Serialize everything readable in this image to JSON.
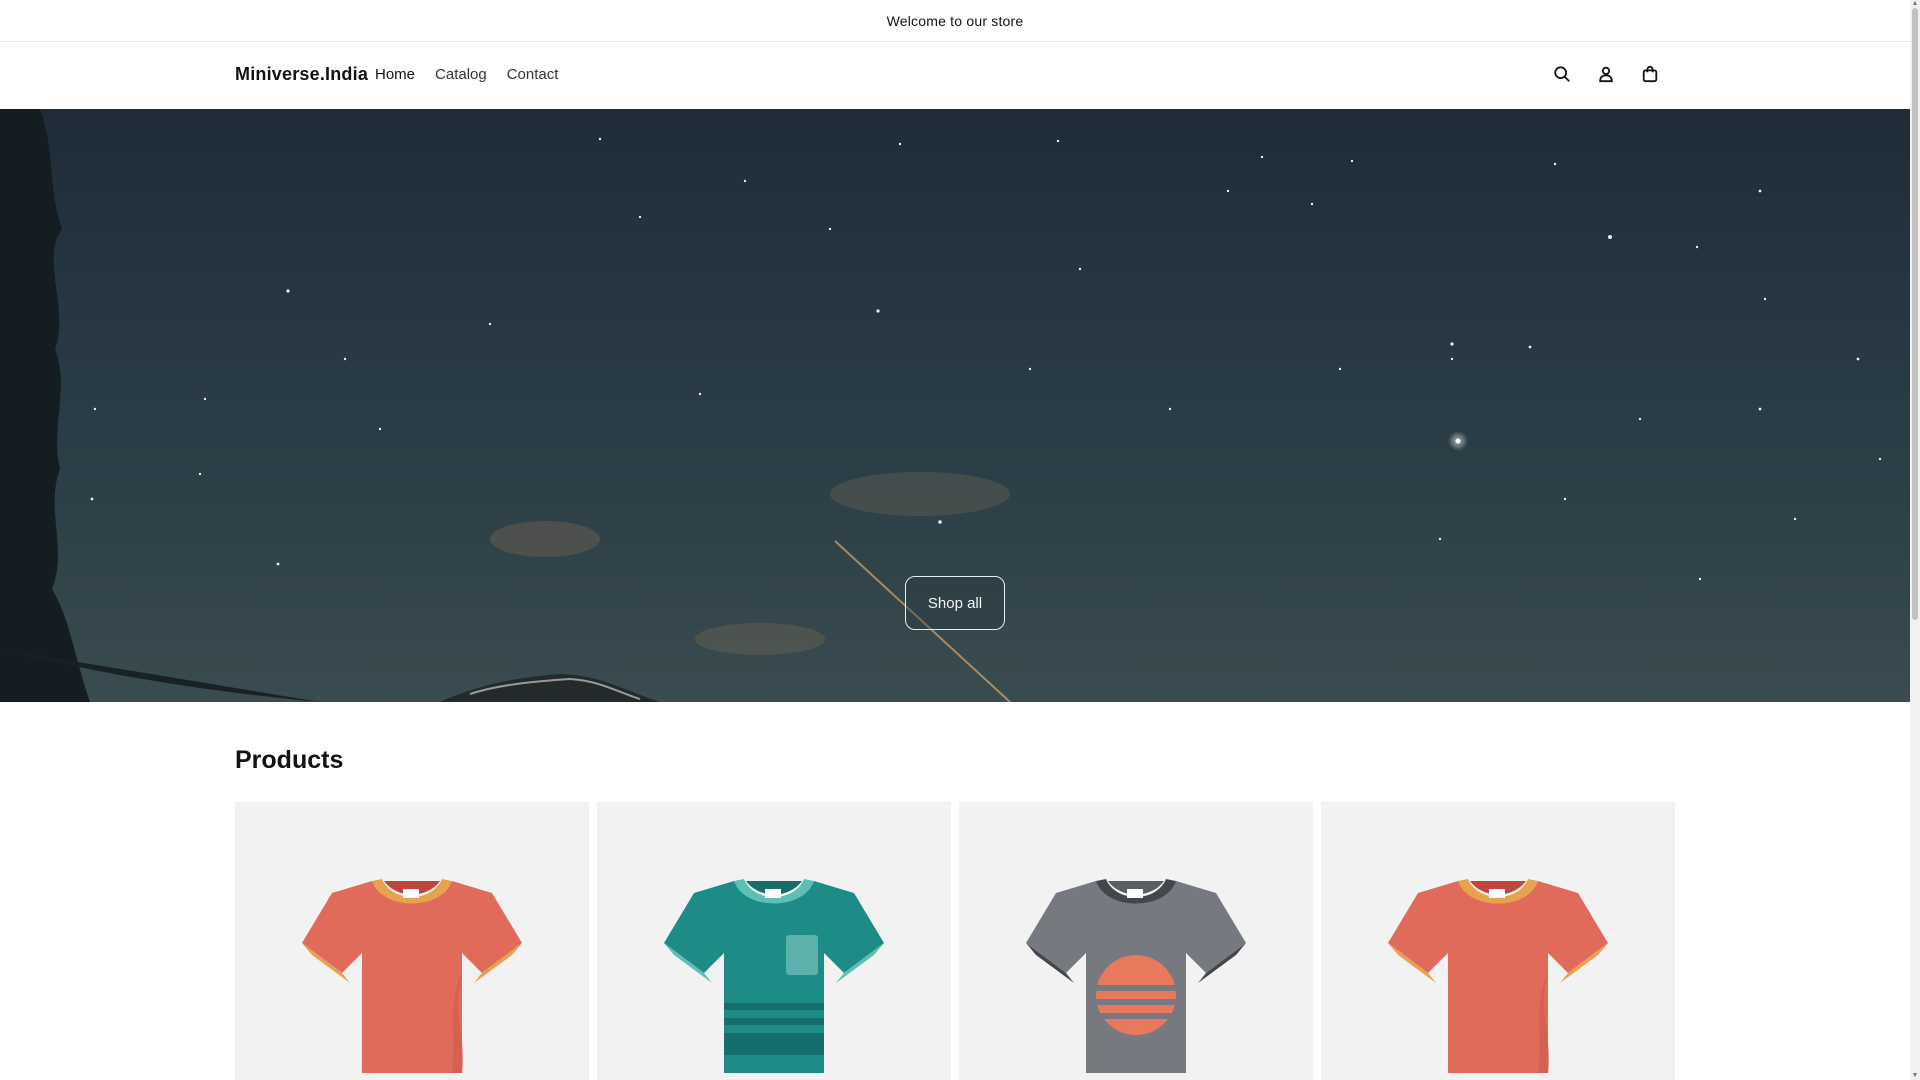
{
  "announcement": {
    "text": "Welcome to our store"
  },
  "header": {
    "logo": "Miniverse.India",
    "nav": [
      {
        "label": "Home"
      },
      {
        "label": "Catalog"
      },
      {
        "label": "Contact"
      }
    ],
    "icons": [
      "search-icon",
      "account-icon",
      "cart-icon"
    ]
  },
  "hero": {
    "button_label": "Shop all"
  },
  "products": {
    "title": "Products",
    "items": [
      {
        "image": "red-tshirt"
      },
      {
        "image": "teal-tshirt"
      },
      {
        "image": "gray-tshirt"
      },
      {
        "image": "red-tshirt"
      }
    ]
  },
  "colors": {
    "accent": "#121212",
    "sky": "#263743",
    "card_bg": "#f2f2f2"
  }
}
